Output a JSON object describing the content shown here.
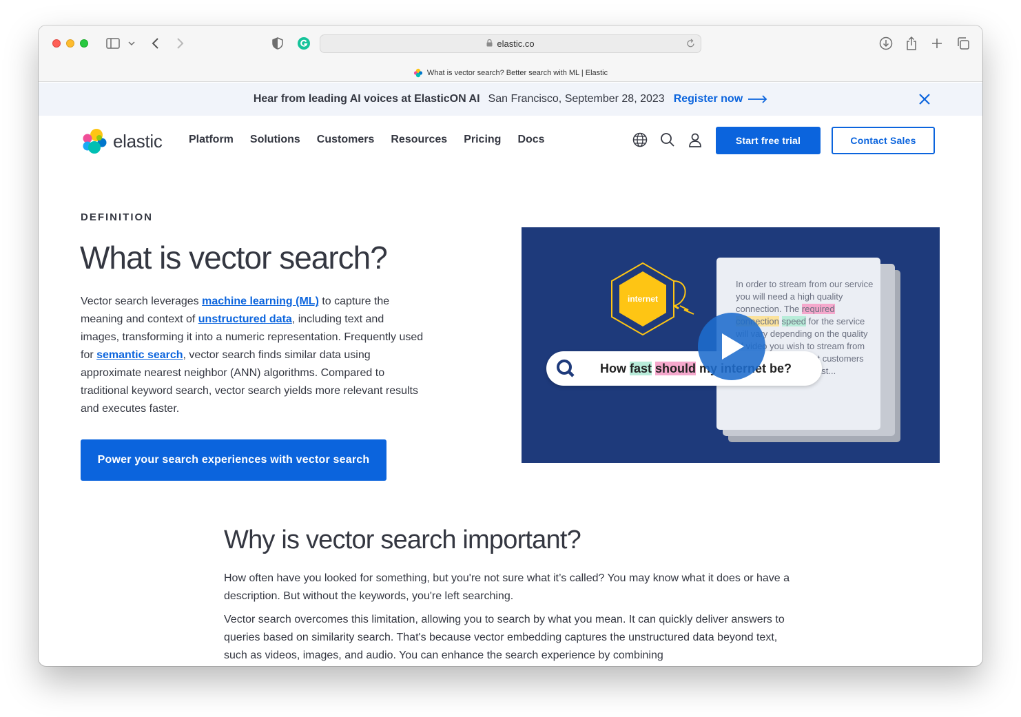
{
  "browser": {
    "url": "elastic.co",
    "tab_title": "What is vector search? Better search with ML | Elastic"
  },
  "banner": {
    "title": "Hear from leading AI voices at ElasticON AI",
    "date": "San Francisco, September 28, 2023",
    "link": "Register now"
  },
  "nav": {
    "logo": "elastic",
    "links": [
      "Platform",
      "Solutions",
      "Customers",
      "Resources",
      "Pricing",
      "Docs"
    ],
    "trial_button": "Start free trial",
    "sales_button": "Contact Sales"
  },
  "hero": {
    "eyebrow": "DEFINITION",
    "title": "What is vector search?",
    "body_1": "Vector search leverages ",
    "link_ml": "machine learning (ML)",
    "body_2": " to capture the meaning and context of ",
    "link_unstructured": "unstructured data",
    "body_3": ", including text and images, transforming it into a numeric representation. Frequently used for ",
    "link_semantic": "semantic search",
    "body_4": ", vector search finds similar data using approximate nearest neighbor (ANN) algorithms. Compared to traditional keyword search, vector search yields more relevant results and executes faster.",
    "cta": "Power your search experiences with vector search"
  },
  "video": {
    "hex_label": "internet",
    "doc_1": "In order to stream from our service you will need a high quality connection. The ",
    "doc_hl_1": "required",
    "doc_hl_2": "connection",
    "doc_hl_3": "speed",
    "doc_2": " for the service will vary depending on the quality of video you wish to stream from our service. For most customers we recommend at least...",
    "query_1": "How ",
    "query_hl_1": "fast",
    "query_hl_2": "should",
    "query_2": " my internet be?"
  },
  "section2": {
    "title": "Why is vector search important?",
    "p1": "How often have you looked for something, but you're not sure what it’s called? You may know what it does or have a description. But without the keywords, you're left searching.",
    "p2": "Vector search overcomes this limitation, allowing you to search by what you mean. It can quickly deliver answers to queries based on similarity search. That's because vector embedding captures the unstructured data beyond text, such as videos, images, and audio. You can enhance the search experience by combining"
  },
  "colors": {
    "brand_blue": "#0b64dd",
    "video_bg": "#1e3a7b",
    "text": "#343741",
    "banner_bg": "#f1f4fa"
  },
  "icons": [
    "sidebar-icon",
    "chevron-down-icon",
    "back-icon",
    "forward-icon",
    "shield-icon",
    "grammarly-icon",
    "lock-icon",
    "reload-icon",
    "download-icon",
    "share-icon",
    "new-tab-icon",
    "tabs-overview-icon",
    "close-icon",
    "globe-icon",
    "search-icon",
    "user-icon",
    "play-icon"
  ]
}
